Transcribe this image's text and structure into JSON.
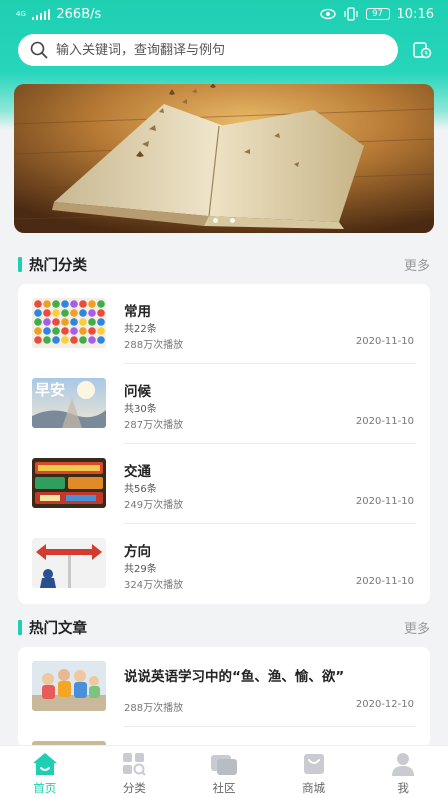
{
  "status_bar": {
    "network": "4G",
    "speed": "266B/s",
    "battery": "97",
    "time": "10:16"
  },
  "search": {
    "placeholder": "输入关键词，查询翻译与例句",
    "icon": "search-icon",
    "history_icon": "history-icon"
  },
  "banner": {
    "icon": "open-book-image",
    "slide_count": 2
  },
  "hot_categories": {
    "title": "热门分类",
    "more": "更多",
    "items": [
      {
        "title": "常用",
        "count": "共22条",
        "plays": "288万次播放",
        "date": "2020-11-10"
      },
      {
        "title": "问候",
        "count": "共30条",
        "plays": "287万次播放",
        "date": "2020-11-10"
      },
      {
        "title": "交通",
        "count": "共56条",
        "plays": "249万次播放",
        "date": "2020-11-10"
      },
      {
        "title": "方向",
        "count": "共29条",
        "plays": "324万次播放",
        "date": "2020-11-10"
      }
    ]
  },
  "hot_articles": {
    "title": "热门文章",
    "more": "更多",
    "items": [
      {
        "title": "说说英语学习中的“鱼、渔、愉、欲”",
        "plays": "288万次播放",
        "date": "2020-12-10"
      }
    ]
  },
  "thumb_text": {
    "greeting": "早安"
  },
  "tabbar": {
    "items": [
      {
        "label": "首页",
        "icon": "home-icon",
        "active": true
      },
      {
        "label": "分类",
        "icon": "category-icon",
        "active": false
      },
      {
        "label": "社区",
        "icon": "community-icon",
        "active": false
      },
      {
        "label": "商城",
        "icon": "shop-icon",
        "active": false
      },
      {
        "label": "我",
        "icon": "profile-icon",
        "active": false
      }
    ]
  },
  "colors": {
    "accent": "#1fcfb2",
    "background": "#f2f3f5"
  }
}
